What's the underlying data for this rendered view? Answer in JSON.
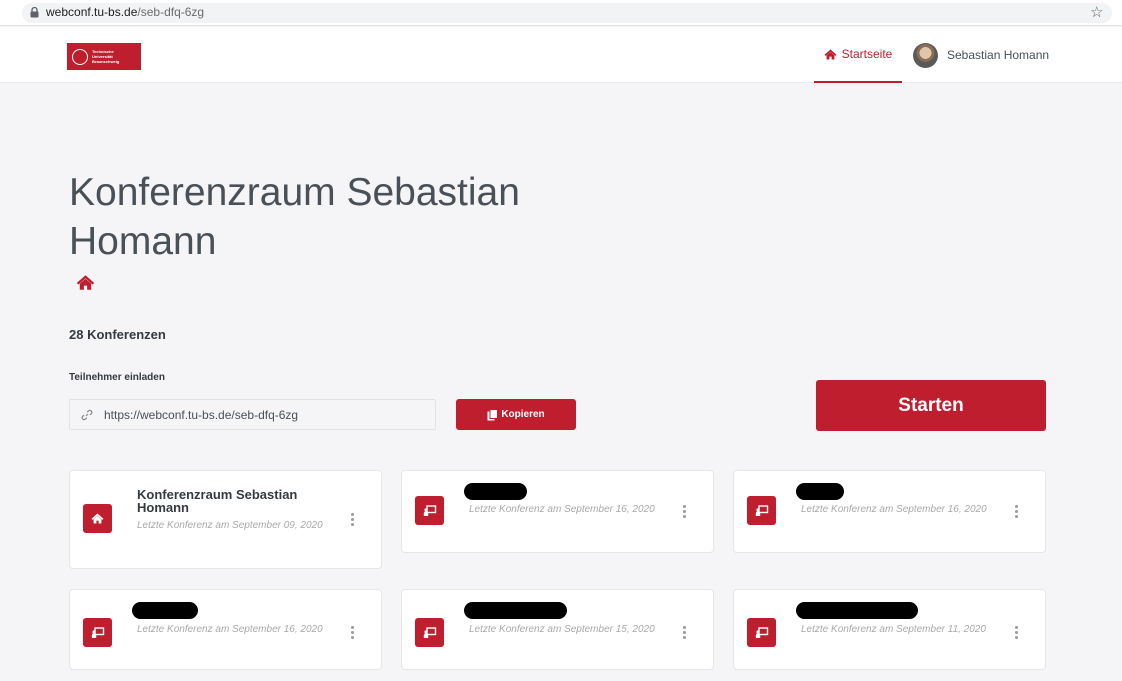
{
  "browser": {
    "url_host": "webconf.tu-bs.de",
    "url_path": "/seb-dfq-6zg",
    "lock_icon": "lock-icon",
    "star_icon": "star-icon"
  },
  "header": {
    "logo_lines": [
      "Technische",
      "Universität",
      "Braunschweig"
    ],
    "nav_home_label": "Startseite",
    "nav_home_icon": "home-icon",
    "user_name": "Sebastian Homann"
  },
  "room": {
    "title": "Konferenzraum Sebastian Homann",
    "conference_count": "28 Konferenzen",
    "invite_label": "Teilnehmer einladen",
    "invite_url": "https://webconf.tu-bs.de/seb-dfq-6zg",
    "copy_label": "Kopieren",
    "start_label": "Starten"
  },
  "colors": {
    "accent": "#be1e2d",
    "background": "#f5f5f7"
  },
  "rooms": [
    {
      "name": "Konferenzraum Sebastian Homann",
      "last": "Letzte Konferenz am September 09, 2020",
      "icon": "home-icon"
    },
    {
      "name": "",
      "last": "Letzte Konferenz am September 16, 2020",
      "icon": "presentation-icon"
    },
    {
      "name": "",
      "last": "Letzte Konferenz am September 16, 2020",
      "icon": "presentation-icon"
    },
    {
      "name": "",
      "last": "Letzte Konferenz am September 16, 2020",
      "icon": "presentation-icon"
    },
    {
      "name": "",
      "last": "Letzte Konferenz am September 15, 2020",
      "icon": "presentation-icon"
    },
    {
      "name": "",
      "last": "Letzte Konferenz am September 11, 2020",
      "icon": "presentation-icon"
    }
  ]
}
